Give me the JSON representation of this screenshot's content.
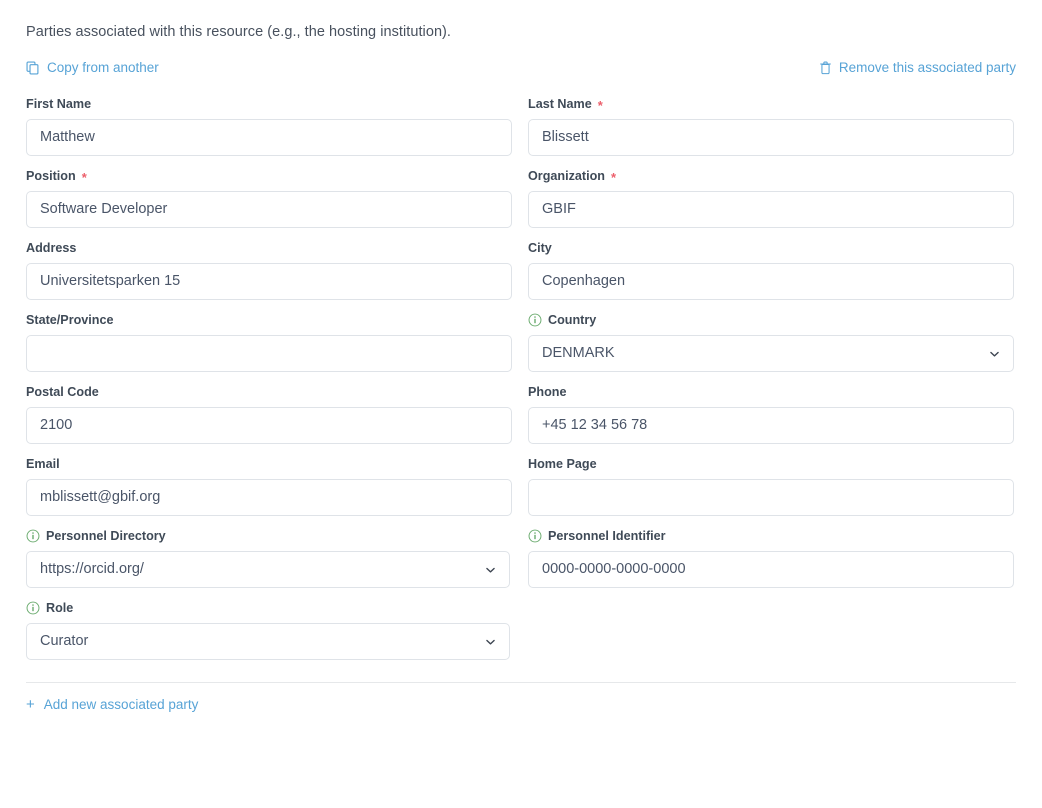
{
  "panel": {
    "intro": "Parties associated with this resource (e.g., the hosting institution).",
    "copy_label": "Copy from another",
    "copy_icon": "copy-icon",
    "remove_label": "Remove this associated party",
    "remove_icon": "trash-icon",
    "add_label": "Add new associated party",
    "add_icon": "plus-icon"
  },
  "colors": {
    "link": "#57a3d6",
    "required": "#ec5f6b",
    "info": "#6aab6e",
    "border": "#dfe3e8",
    "text": "#4a5568"
  },
  "fields": {
    "first_name": {
      "label": "First Name",
      "required": false,
      "info": false,
      "type": "text",
      "value": "Matthew",
      "placeholder": ""
    },
    "last_name": {
      "label": "Last Name",
      "required": true,
      "info": false,
      "type": "text",
      "value": "Blissett",
      "placeholder": ""
    },
    "position": {
      "label": "Position",
      "required": true,
      "info": false,
      "type": "text",
      "value": "Software Developer",
      "placeholder": ""
    },
    "organization": {
      "label": "Organization",
      "required": true,
      "info": false,
      "type": "text",
      "value": "GBIF",
      "placeholder": ""
    },
    "address": {
      "label": "Address",
      "required": false,
      "info": false,
      "type": "text",
      "value": "Universitetsparken 15",
      "placeholder": ""
    },
    "city": {
      "label": "City",
      "required": false,
      "info": false,
      "type": "text",
      "value": "Copenhagen",
      "placeholder": ""
    },
    "state_province": {
      "label": "State/Province",
      "required": false,
      "info": false,
      "type": "text",
      "value": "",
      "placeholder": ""
    },
    "country": {
      "label": "Country",
      "required": false,
      "info": true,
      "type": "select",
      "value": "DENMARK",
      "placeholder": ""
    },
    "postal_code": {
      "label": "Postal Code",
      "required": false,
      "info": false,
      "type": "text",
      "value": "2100",
      "placeholder": ""
    },
    "phone": {
      "label": "Phone",
      "required": false,
      "info": false,
      "type": "text",
      "value": "+45 12 34 56 78",
      "placeholder": ""
    },
    "email": {
      "label": "Email",
      "required": false,
      "info": false,
      "type": "text",
      "value": "mblissett@gbif.org",
      "placeholder": ""
    },
    "home_page": {
      "label": "Home Page",
      "required": false,
      "info": false,
      "type": "text",
      "value": "",
      "placeholder": ""
    },
    "personnel_directory": {
      "label": "Personnel Directory",
      "required": false,
      "info": true,
      "type": "select",
      "value": "https://orcid.org/",
      "placeholder": ""
    },
    "personnel_identifier": {
      "label": "Personnel Identifier",
      "required": false,
      "info": true,
      "type": "text",
      "value": "0000-0000-0000-0000",
      "placeholder": ""
    },
    "role": {
      "label": "Role",
      "required": false,
      "info": true,
      "type": "select",
      "value": "Curator",
      "placeholder": ""
    }
  }
}
